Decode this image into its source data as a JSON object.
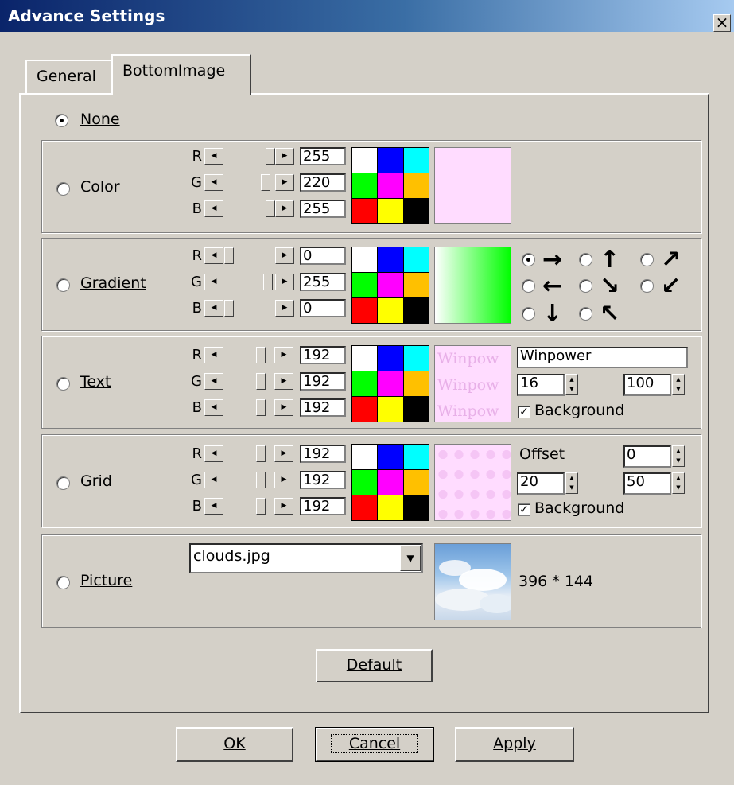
{
  "window": {
    "title": "Advance Settings",
    "close_label": "×"
  },
  "tabs": [
    {
      "label": "General"
    },
    {
      "label": "BottomImage"
    }
  ],
  "none_option": {
    "label": "None"
  },
  "channels": [
    "R",
    "G",
    "B"
  ],
  "palette_colors": [
    "#ffffff",
    "#0000ff",
    "#00ffff",
    "#00ff00",
    "#ff00ff",
    "#ffc000",
    "#ff0000",
    "#ffff00",
    "#000000"
  ],
  "color_section": {
    "label": "Color",
    "values": [
      "255",
      "220",
      "255"
    ],
    "preview_color": "#ffdcff"
  },
  "gradient_section": {
    "label": "Gradient",
    "values": [
      "0",
      "255",
      "0"
    ],
    "directions": [
      {
        "arrow": "→",
        "selected": true
      },
      {
        "arrow": "↑",
        "selected": false
      },
      {
        "arrow": "↗",
        "selected": false
      },
      {
        "arrow": "←",
        "selected": false
      },
      {
        "arrow": "↘",
        "selected": false
      },
      {
        "arrow": "↙",
        "selected": false
      },
      {
        "arrow": "↓",
        "selected": false
      },
      {
        "arrow": "↖",
        "selected": false
      }
    ]
  },
  "text_section": {
    "label": "Text",
    "values": [
      "192",
      "192",
      "192"
    ],
    "text_value": "Winpower",
    "preview_text": "Winpow",
    "size_value": "16",
    "alpha_value": "100",
    "background_label": "Background"
  },
  "grid_section": {
    "label": "Grid",
    "values": [
      "192",
      "192",
      "192"
    ],
    "offset_label": "Offset",
    "offset_value": "0",
    "width_value": "20",
    "height_value": "50",
    "background_label": "Background"
  },
  "picture_section": {
    "label": "Picture",
    "file": "clouds.jpg",
    "dimensions": "396 * 144"
  },
  "buttons": {
    "default": "Default",
    "ok": "OK",
    "cancel": "Cancel",
    "apply": "Apply"
  }
}
